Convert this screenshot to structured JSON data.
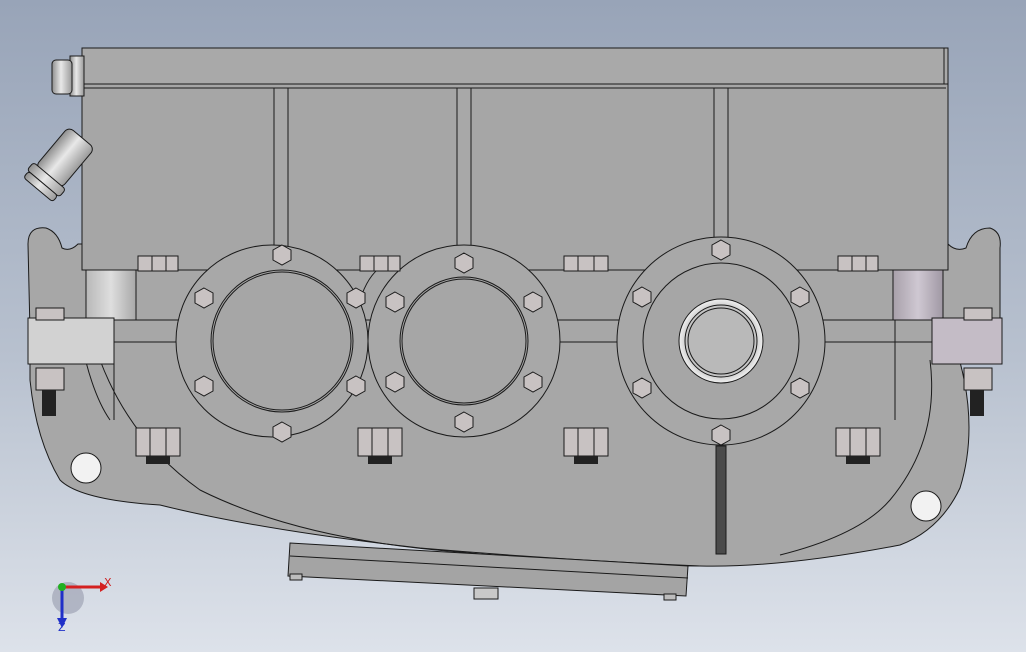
{
  "viewport": {
    "background_top": "#98a4b8",
    "background_bottom": "#dde2ea"
  },
  "model": {
    "body_color": "#a8a8a8",
    "line_color": "#1a1a1a",
    "bolt_color": "#c8c2c2",
    "highlight_color": "#d8d8d8"
  },
  "triad": {
    "x_label": "X",
    "z_label": "Z",
    "x_color": "#d42020",
    "y_color": "#20b020",
    "z_color": "#2030c8"
  }
}
